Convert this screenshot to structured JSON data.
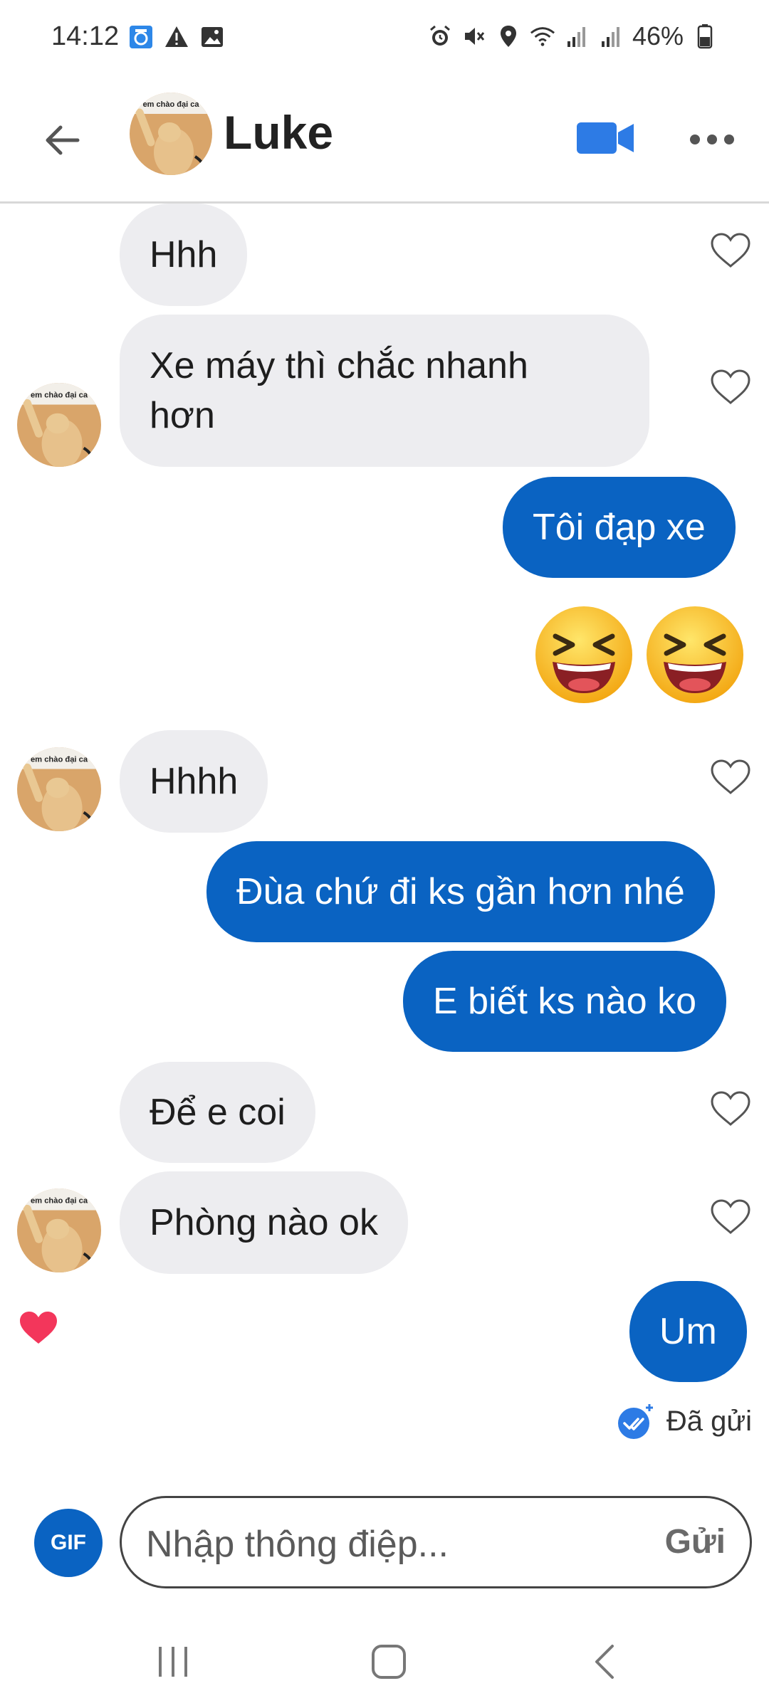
{
  "status_bar": {
    "time": "14:12",
    "battery": "46%",
    "icons_left": [
      "photo-sync-icon",
      "warning-icon",
      "image-icon"
    ],
    "icons_right": [
      "alarm-icon",
      "mute-icon",
      "location-icon",
      "wifi-icon",
      "signal-icon",
      "signal-icon",
      "battery-icon"
    ]
  },
  "header": {
    "contact_name": "Luke",
    "avatar_caption": "em chào đại ca"
  },
  "messages": [
    {
      "text": "Hhh",
      "direction": "incoming"
    },
    {
      "text": "Xe máy thì chắc nhanh hơn",
      "line1": "Xe máy thì chắc nhanh",
      "line2": "hơn",
      "direction": "incoming"
    },
    {
      "text": "Tôi đạp xe",
      "direction": "outgoing"
    },
    {
      "text": "😆😆",
      "direction": "outgoing",
      "type": "emoji"
    },
    {
      "text": "Hhhh",
      "direction": "incoming"
    },
    {
      "text": "Đùa chứ đi ks gần hơn nhé",
      "direction": "outgoing"
    },
    {
      "text": "E biết ks nào ko",
      "direction": "outgoing"
    },
    {
      "text": "Để e coi",
      "direction": "incoming"
    },
    {
      "text": "Phòng nào ok",
      "direction": "incoming"
    },
    {
      "text": "Um",
      "direction": "outgoing"
    }
  ],
  "sent_status": "Đã gửi",
  "composer": {
    "gif_label": "GIF",
    "placeholder": "Nhập thông điệp...",
    "send_label": "Gửi"
  },
  "colors": {
    "outgoing_bubble": "#0a63c2",
    "incoming_bubble": "#ededf0",
    "accent": "#2d7be5",
    "heart_reaction": "#f3365b"
  }
}
